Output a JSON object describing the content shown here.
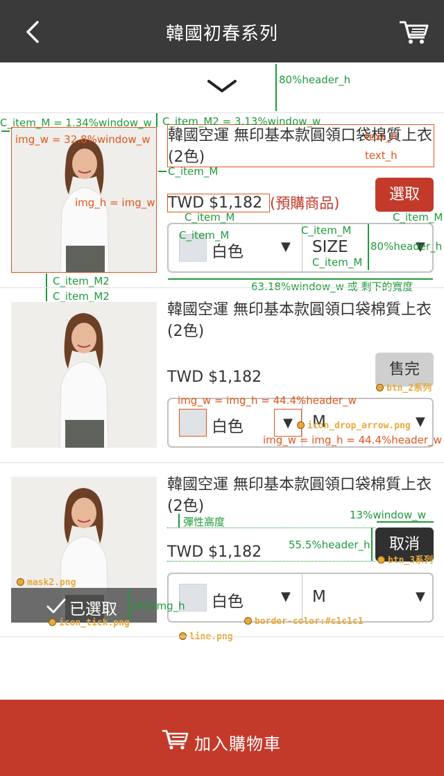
{
  "header": {
    "title": "韓國初春系列"
  },
  "colors": {
    "header_bg": "#3a3a3a",
    "accent": "#c33a2b",
    "border": "#c1c1c1",
    "annotation_green": "#1f9a3a",
    "annotation_orange": "#e0561c"
  },
  "items": [
    {
      "name": "韓國空運 無印基本款圓領口袋棉質上衣(2色)",
      "price": "TWD $1,182",
      "preorder": "(預購商品)",
      "button": "選取",
      "color": "白色",
      "size": "SIZE"
    },
    {
      "name": "韓國空運 無印基本款圓領口袋棉質上衣(2色)",
      "price": "TWD $1,182",
      "button": "售完",
      "color": "白色",
      "size": "M"
    },
    {
      "name": "韓國空運 無印基本款圓領口袋棉質上衣(2色)",
      "price": "TWD $1,182",
      "button": "取消",
      "color": "白色",
      "size": "M",
      "selected_label": "已選取"
    }
  ],
  "footer": {
    "label": "加入購物車"
  },
  "annotations": {
    "a1": "80%header_h",
    "a2": "C_item_M = 1.34%window_w",
    "a3": "C_item_M2 = 3.13%window_w",
    "a4": "img_w = 32.8%window_w",
    "a5": "img_h = img_w",
    "a6": "text_h",
    "a7": "text_h",
    "a8": "C_item_M",
    "a9": "C_item_M",
    "a10": "C_item_M",
    "a11": "C_item_M",
    "a12": "C_item_M",
    "a13": "C_item_M",
    "a14": "80%header_h",
    "a15": "C_item_M2",
    "a16": "C_item_M2",
    "a17": "63.18%window_w 或 剩下的寬度",
    "a18": "img_w = img_h = 44.4%header_w",
    "a19": "img_w = img_h = 44.4%header_w",
    "a20": "icon_drop_arrow.png",
    "a21": "btn_2系列",
    "a22": "13%window_w",
    "a23": "彈性高度",
    "a24": "55.5%header_h",
    "a25": "btn_3系列",
    "a26": "mask2.png",
    "a27": "24%img_h",
    "a28": "icon_tick.png",
    "a29": "border-color:#c1c1c1",
    "a30": "line.png"
  }
}
